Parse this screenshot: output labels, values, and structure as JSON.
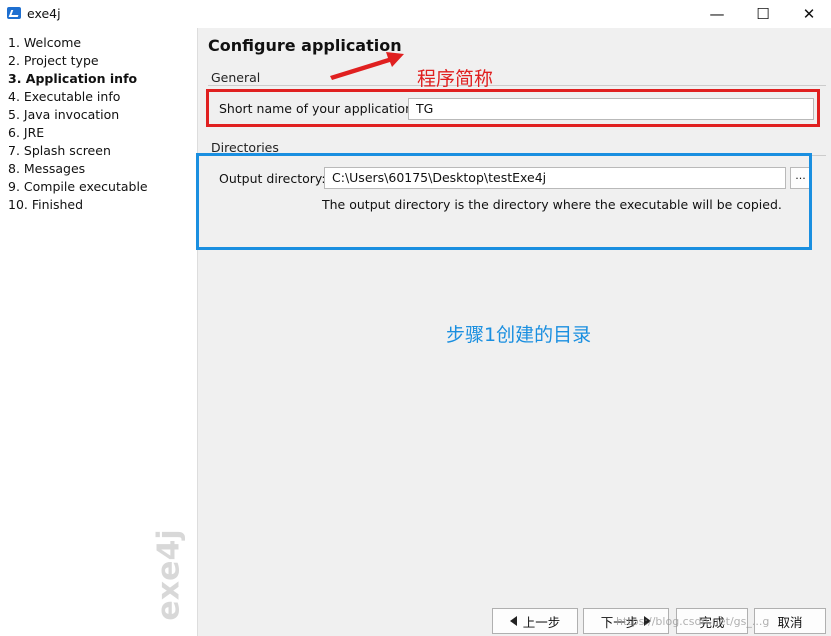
{
  "window": {
    "title": "exe4j",
    "minimize": "—",
    "maximize": "☐",
    "close": "✕"
  },
  "sidebar": {
    "steps": [
      {
        "label": "1. Welcome"
      },
      {
        "label": "2. Project type"
      },
      {
        "label": "3. Application info",
        "active": true
      },
      {
        "label": "4. Executable info"
      },
      {
        "label": "5. Java invocation"
      },
      {
        "label": "6. JRE"
      },
      {
        "label": "7. Splash screen"
      },
      {
        "label": "8. Messages"
      },
      {
        "label": "9. Compile executable"
      },
      {
        "label": "10. Finished"
      }
    ],
    "logo_text": "exe4j"
  },
  "main": {
    "page_title": "Configure application",
    "general": {
      "group_label": "General",
      "short_name_label": "Short name of your application:",
      "short_name_value": "TG"
    },
    "directories": {
      "group_label": "Directories",
      "output_label": "Output directory:",
      "output_value": "C:\\Users\\60175\\Desktop\\testExe4j",
      "browse_label": "...",
      "hint": "The output directory is the directory where the executable will be copied."
    }
  },
  "annotations": {
    "red_text": "程序简称",
    "blue_text": "步骤1创建的目录",
    "red_color": "#e02020",
    "blue_color": "#1a8fe0"
  },
  "nav": {
    "back_label": "上一步",
    "next_label": "下一步",
    "finish_label": "完成",
    "cancel_label": "取消"
  },
  "watermark": "https://blog.csdn.net/gs_...g"
}
